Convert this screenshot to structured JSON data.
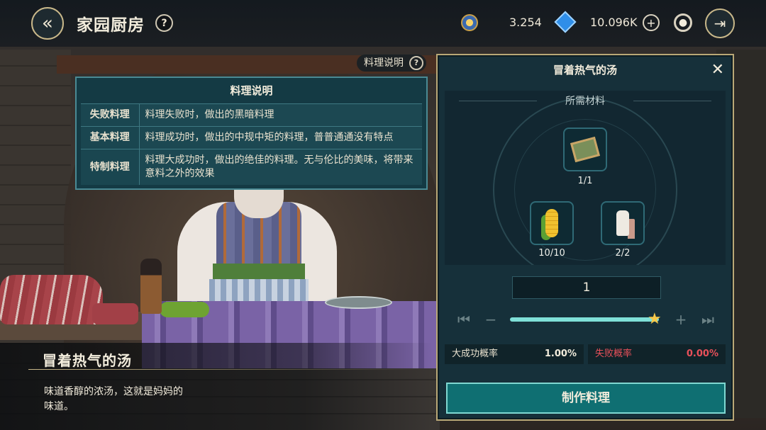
{
  "header": {
    "title": "家园厨房",
    "help_label": "?",
    "gold_value": "3.254",
    "gem_value": "10.096K",
    "plus_label": "+"
  },
  "info_tag": {
    "label": "料理说明"
  },
  "info_popup": {
    "title": "料理说明",
    "rows": [
      {
        "name": "失败料理",
        "desc": "料理失败时，做出的黑暗料理"
      },
      {
        "name": "基本料理",
        "desc": "料理成功时，做出的中规中矩的料理，普普通通没有特点"
      },
      {
        "name": "特制料理",
        "desc": "料理大成功时，做出的绝佳的料理。无与伦比的美味，将带来意料之外的效果"
      }
    ]
  },
  "dish": {
    "name": "冒着热气的汤",
    "desc": "味道香醇的浓汤，这就是妈妈的味道。"
  },
  "panel": {
    "title": "冒着热气的汤",
    "close_label": "✕",
    "materials_header": "所需材料",
    "materials": [
      {
        "icon": "map-icon",
        "count": "1/1"
      },
      {
        "icon": "corn-icon",
        "count": "10/10"
      },
      {
        "icon": "milk-icon",
        "count": "2/2"
      }
    ],
    "quantity": "1",
    "slider_level": 1.0,
    "great_success_label": "大成功概率",
    "great_success_value": "1.00%",
    "fail_label": "失败概率",
    "fail_value": "0.00%",
    "make_button": "制作料理"
  },
  "colors": {
    "accent": "#0f6f72",
    "success_value": "#f2ecdc",
    "fail_text": "#e8505a",
    "slider": "#7fe0d8",
    "gold_frame": "#b9a877"
  }
}
